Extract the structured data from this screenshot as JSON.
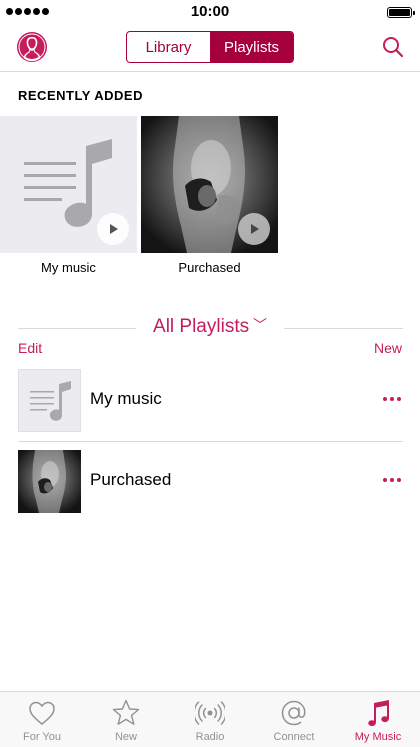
{
  "status_bar": {
    "time": "10:00"
  },
  "nav": {
    "segments": [
      {
        "label": "Library",
        "active": false
      },
      {
        "label": "Playlists",
        "active": true
      }
    ],
    "profile_icon": "profile-icon",
    "search_icon": "search-icon"
  },
  "recently_added": {
    "heading": "RECENTLY ADDED",
    "items": [
      {
        "title": "My music",
        "art": "music-note-placeholder"
      },
      {
        "title": "Purchased",
        "art": "album-art-photo"
      }
    ]
  },
  "playlists": {
    "heading": "All Playlists",
    "edit_label": "Edit",
    "new_label": "New",
    "items": [
      {
        "name": "My music"
      },
      {
        "name": "Purchased"
      }
    ]
  },
  "tab_bar": {
    "tabs": [
      {
        "label": "For You",
        "icon": "heart-icon"
      },
      {
        "label": "New",
        "icon": "star-icon"
      },
      {
        "label": "Radio",
        "icon": "radio-icon"
      },
      {
        "label": "Connect",
        "icon": "at-icon"
      },
      {
        "label": "My Music",
        "icon": "music-note-icon",
        "active": true
      }
    ]
  },
  "colors": {
    "accent": "#c51c5c",
    "segment": "#a5003b",
    "inactive": "#929292"
  }
}
